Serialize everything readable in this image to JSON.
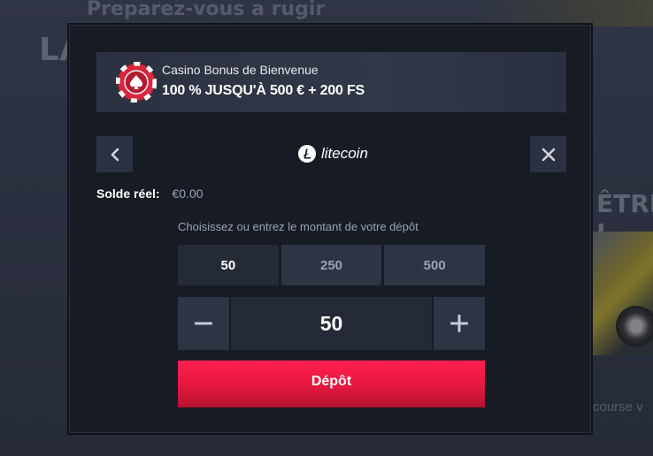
{
  "background": {
    "hero_text": "Preparez-vous a rugir",
    "left_title": "LA",
    "right_title": "ÊTRE L",
    "right_link": "course v"
  },
  "bonus": {
    "title": "Casino Bonus de Bienvenue",
    "offer": "100 % JUSQU'À 500 € + 200 FS",
    "icon": "casino-chip-icon"
  },
  "header": {
    "back_icon": "chevron-left-icon",
    "close_icon": "close-icon",
    "payment_method": "litecoin",
    "payment_logo": "litecoin-logo"
  },
  "balance": {
    "label": "Solde réel:",
    "value": "€0.00"
  },
  "deposit_form": {
    "prompt": "Choisissez ou entrez le montant de votre dépôt",
    "presets": [
      "50",
      "250",
      "500"
    ],
    "selected_preset": "50",
    "amount": "50",
    "minus_icon": "minus-icon",
    "plus_icon": "plus-icon",
    "submit_label": "Dépôt"
  },
  "colors": {
    "modal_bg": "#171b24",
    "accent_red": "#e8183f",
    "button_bg": "#2d3443"
  }
}
